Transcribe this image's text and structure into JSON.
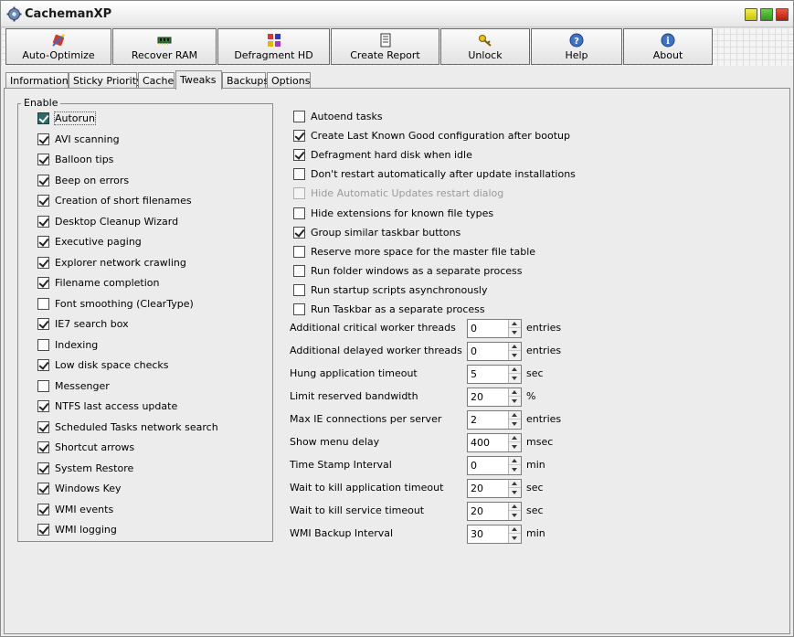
{
  "window": {
    "title": "CachemanXP"
  },
  "toolbar": {
    "buttons": [
      {
        "label": "Auto-Optimize"
      },
      {
        "label": "Recover RAM"
      },
      {
        "label": "Defragment HD"
      },
      {
        "label": "Create Report"
      },
      {
        "label": "Unlock"
      },
      {
        "label": "Help"
      },
      {
        "label": "About"
      }
    ]
  },
  "tabs": [
    {
      "label": "Information"
    },
    {
      "label": "Sticky Priority"
    },
    {
      "label": "Cache"
    },
    {
      "label": "Tweaks",
      "active": true
    },
    {
      "label": "Backups"
    },
    {
      "label": "Options"
    }
  ],
  "enable_group": {
    "legend": "Enable",
    "items": [
      {
        "label": "Autorun",
        "checked": true
      },
      {
        "label": "AVI scanning",
        "checked": true
      },
      {
        "label": "Balloon tips",
        "checked": true
      },
      {
        "label": "Beep on errors",
        "checked": true
      },
      {
        "label": "Creation of short filenames",
        "checked": true
      },
      {
        "label": "Desktop Cleanup Wizard",
        "checked": true
      },
      {
        "label": "Executive paging",
        "checked": true
      },
      {
        "label": "Explorer network crawling",
        "checked": true
      },
      {
        "label": "Filename completion",
        "checked": true
      },
      {
        "label": "Font smoothing (ClearType)",
        "checked": false
      },
      {
        "label": "IE7 search box",
        "checked": true
      },
      {
        "label": "Indexing",
        "checked": false
      },
      {
        "label": "Low disk space checks",
        "checked": true
      },
      {
        "label": "Messenger",
        "checked": false
      },
      {
        "label": "NTFS last access update",
        "checked": true
      },
      {
        "label": "Scheduled Tasks network search",
        "checked": true
      },
      {
        "label": "Shortcut arrows",
        "checked": true
      },
      {
        "label": "System Restore",
        "checked": true
      },
      {
        "label": "Windows Key",
        "checked": true
      },
      {
        "label": "WMI events",
        "checked": true
      },
      {
        "label": "WMI logging",
        "checked": true
      }
    ]
  },
  "right_options": [
    {
      "label": "Autoend tasks",
      "checked": false
    },
    {
      "label": "Create Last Known Good configuration after bootup",
      "checked": true
    },
    {
      "label": "Defragment hard disk when idle",
      "checked": true
    },
    {
      "label": "Don't restart automatically after update installations",
      "checked": false
    },
    {
      "label": "Hide Automatic Updates restart dialog",
      "checked": false,
      "disabled": true
    },
    {
      "label": "Hide extensions for known file types",
      "checked": false
    },
    {
      "label": "Group similar taskbar buttons",
      "checked": true
    },
    {
      "label": "Reserve more space for the master file table",
      "checked": false
    },
    {
      "label": "Run folder windows as a separate process",
      "checked": false
    },
    {
      "label": "Run startup scripts asynchronously",
      "checked": false
    },
    {
      "label": "Run Taskbar as a separate process",
      "checked": false
    }
  ],
  "settings": [
    {
      "label": "Additional critical worker threads",
      "value": "0",
      "unit": "entries"
    },
    {
      "label": "Additional delayed worker threads",
      "value": "0",
      "unit": "entries"
    },
    {
      "label": "Hung application timeout",
      "value": "5",
      "unit": "sec"
    },
    {
      "label": "Limit reserved bandwidth",
      "value": "20",
      "unit": "%"
    },
    {
      "label": "Max IE connections per server",
      "value": "2",
      "unit": "entries"
    },
    {
      "label": "Show menu delay",
      "value": "400",
      "unit": "msec"
    },
    {
      "label": "Time Stamp Interval",
      "value": "0",
      "unit": "min"
    },
    {
      "label": "Wait to kill application timeout",
      "value": "20",
      "unit": "sec"
    },
    {
      "label": "Wait to kill service timeout",
      "value": "20",
      "unit": "sec"
    },
    {
      "label": "WMI Backup Interval",
      "value": "30",
      "unit": "min"
    }
  ]
}
